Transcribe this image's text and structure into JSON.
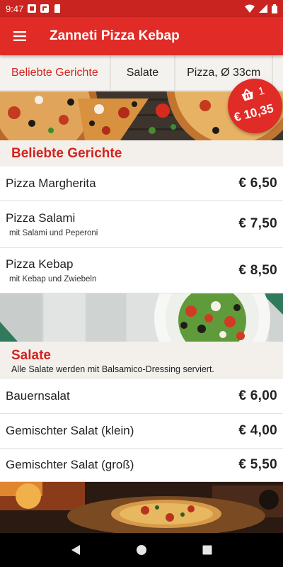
{
  "status": {
    "time": "9:47"
  },
  "app": {
    "title": "Zanneti Pizza Kebap"
  },
  "tabs": [
    {
      "label": "Beliebte Gerichte"
    },
    {
      "label": "Salate"
    },
    {
      "label": "Pizza, Ø 33cm"
    }
  ],
  "cart": {
    "count": "1",
    "total": "€ 10,35"
  },
  "sections": {
    "popular": {
      "title": "Beliebte Gerichte",
      "items": [
        {
          "name": "Pizza Margherita",
          "desc": "",
          "price": "€ 6,50"
        },
        {
          "name": "Pizza Salami",
          "desc": "mit Salami und Peperoni",
          "price": "€ 7,50"
        },
        {
          "name": "Pizza Kebap",
          "desc": "mit Kebap und Zwiebeln",
          "price": "€ 8,50"
        }
      ]
    },
    "salads": {
      "title": "Salate",
      "desc": "Alle Salate werden mit Balsamico-Dressing serviert.",
      "items": [
        {
          "name": "Bauernsalat",
          "price": "€ 6,00"
        },
        {
          "name": "Gemischter Salat (klein)",
          "price": "€ 4,00"
        },
        {
          "name": "Gemischter Salat (groß)",
          "price": "€ 5,50"
        }
      ]
    }
  },
  "colors": {
    "brand": "#e02b26",
    "status_bar": "#c9241f",
    "accent_text": "#d4231e"
  },
  "icons": [
    "menu-icon",
    "cart-icon",
    "back-icon",
    "home-icon",
    "recents-icon"
  ]
}
